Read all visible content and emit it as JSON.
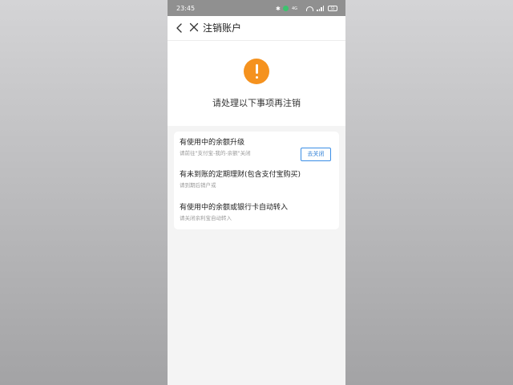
{
  "status_bar": {
    "time": "23:45",
    "network_label": "4G",
    "battery": "52"
  },
  "nav": {
    "title": "注销账户"
  },
  "hero": {
    "message": "请处理以下事项再注销",
    "icon": "exclamation-icon",
    "icon_color": "#f5921e"
  },
  "items": [
    {
      "title": "有使用中的余额升级",
      "subtitle": "请前往\"支付宝-我的-余额\"关闭",
      "button": "去关闭"
    },
    {
      "title": "有未到账的定期理财(包含支付宝购买)",
      "subtitle": "请到期后销户或"
    },
    {
      "title": "有使用中的余额或银行卡自动转入",
      "subtitle": "请关闭余利宝自动转入"
    }
  ],
  "colors": {
    "accent": "#2f7fd6",
    "warning": "#f5921e"
  }
}
